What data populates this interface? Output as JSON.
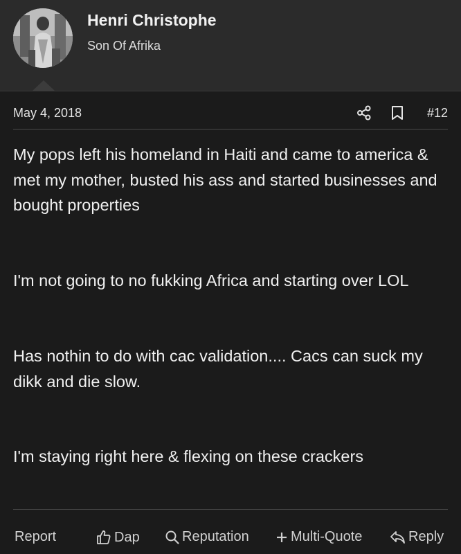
{
  "user": {
    "name": "Henri Christophe",
    "title": "Son Of Afrika"
  },
  "post": {
    "date": "May 4, 2018",
    "number": "#12",
    "paragraphs": [
      "My pops left his homeland in Haiti and came to america & met my mother, busted his ass and started businesses and bought properties",
      "I'm not going to no fukking Africa and starting over LOL",
      "Has nothin to do with cac validation.... Cacs can suck my dikk and die slow.",
      "I'm staying right here & flexing on these crackers"
    ]
  },
  "actions": {
    "report": "Report",
    "dap": "Dap",
    "reputation": "Reputation",
    "multi_quote": "Multi-Quote",
    "reply": "Reply"
  },
  "icons": {
    "share": "share-icon",
    "bookmark": "bookmark-icon",
    "dap": "thumbs-up-icon",
    "reputation": "search-icon",
    "multi_quote": "plus-icon",
    "reply": "reply-icon"
  },
  "colors": {
    "background": "#1b1b1b",
    "header_background": "#2b2b2b",
    "text": "#f0f0f0",
    "muted_text": "#d0d0d0",
    "divider": "#4a4a4a"
  }
}
